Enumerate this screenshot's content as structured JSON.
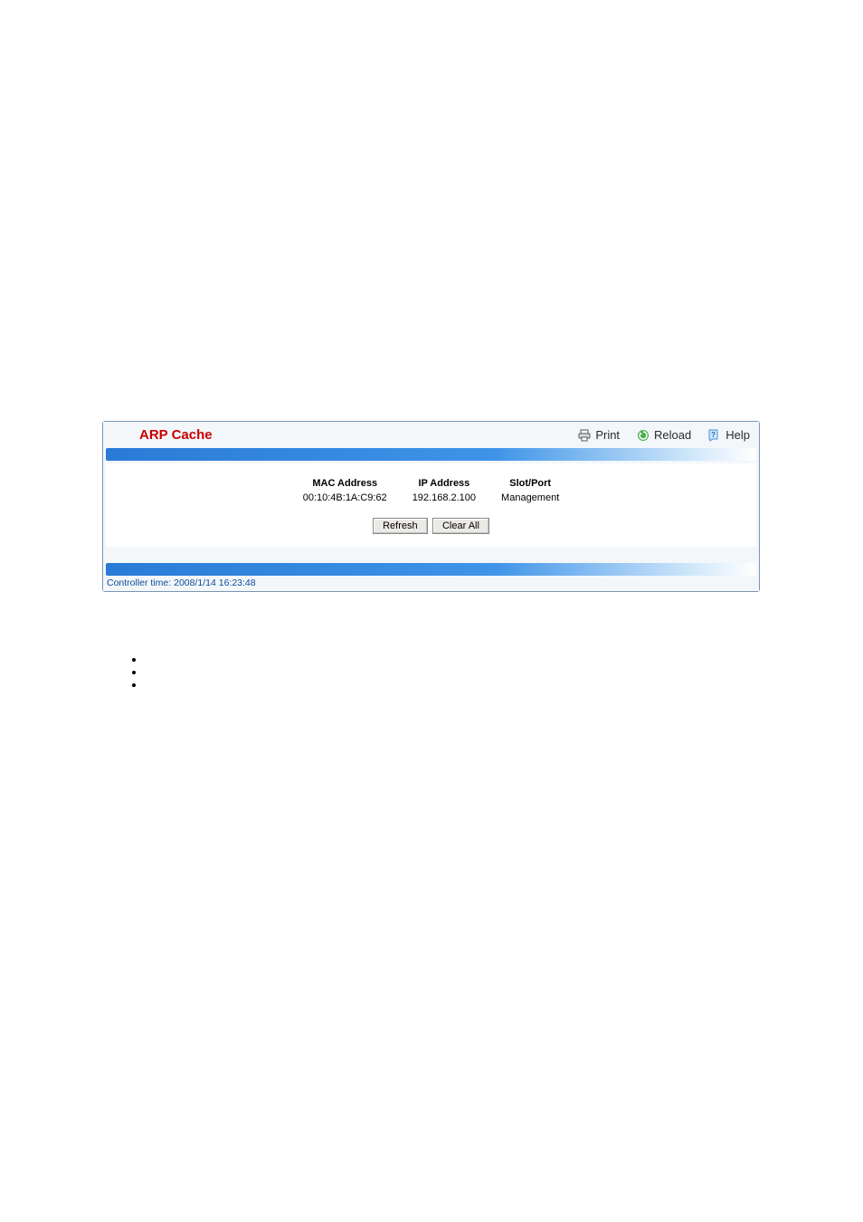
{
  "header": {
    "title": "ARP Cache",
    "actions": {
      "print": "Print",
      "reload": "Reload",
      "help": "Help"
    }
  },
  "table": {
    "columns": {
      "mac": "MAC Address",
      "ip": "IP Address",
      "slot": "Slot/Port"
    },
    "rows": [
      {
        "mac": "00:10:4B:1A:C9:62",
        "ip": "192.168.2.100",
        "slot": "Management"
      }
    ]
  },
  "buttons": {
    "refresh": "Refresh",
    "clear_all": "Clear All"
  },
  "footer": {
    "controller_time": "Controller time: 2008/1/14 16:23:48"
  }
}
